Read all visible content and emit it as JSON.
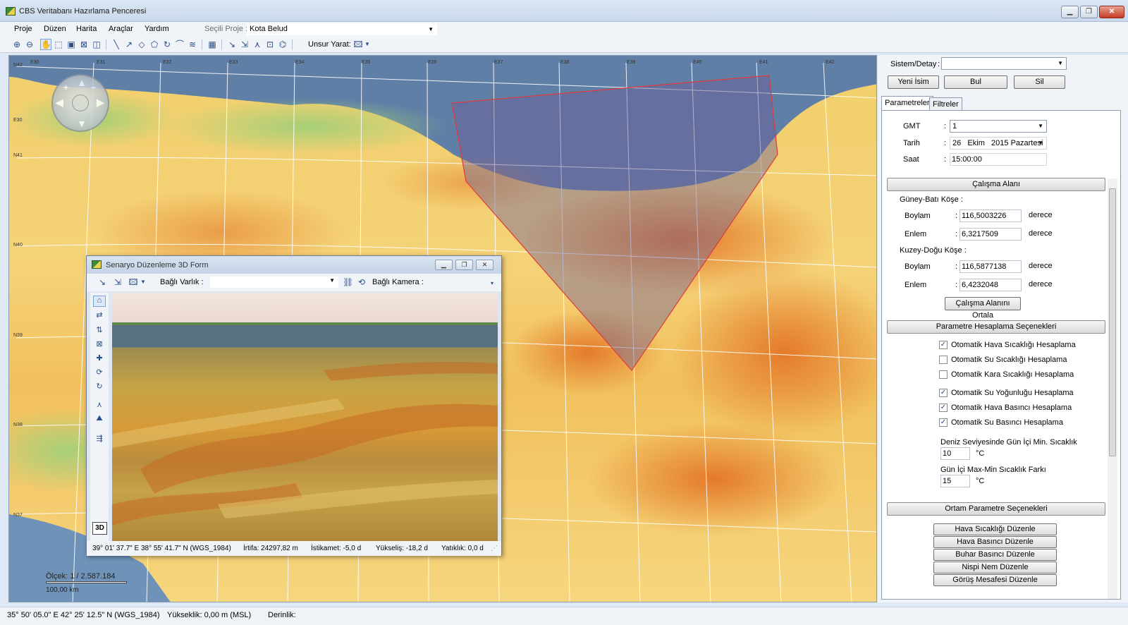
{
  "window": {
    "title": "CBS Veritabanı Hazırlama Penceresi"
  },
  "menu": {
    "items": [
      "Proje",
      "Düzen",
      "Harita",
      "Araçlar",
      "Yardım"
    ],
    "project_label": "Seçili Proje :",
    "project_value": "Kota Belud"
  },
  "toolbar": {
    "unsur_label": "Unsur Yarat:"
  },
  "map": {
    "scale_text": "Ölçek: 1 / 2.587.184",
    "scale_km": "100,00 km"
  },
  "form3d": {
    "title": "Senaryo Düzenleme 3D Form",
    "linked_entity_label": "Bağlı Varlık :",
    "linked_camera_label": "Bağlı Kamera :",
    "btn3d": "3D",
    "status": {
      "coords": "39° 01' 37.7\" E  38° 55' 41.7\" N (WGS_1984)",
      "altitude": "İrtifa: 24297,82 m",
      "heading": "İstikamet: -5,0 d",
      "elevation": "Yükseliş: -18,2 d",
      "tilt": "Yatıklık: 0,0 d"
    }
  },
  "right_panel": {
    "sistem_label": "Sistem/Detay",
    "buttons": {
      "yeni": "Yeni İsim",
      "bul": "Bul",
      "sil": "Sil"
    },
    "tabs": [
      "Parametreler",
      "Filtreler"
    ],
    "gmt_label": "GMT",
    "gmt_value": "1",
    "tarih_label": "Tarih",
    "tarih_day": "26",
    "tarih_month": "Ekim",
    "tarih_rest": "2015 Pazartesi",
    "saat_label": "Saat",
    "saat_value": "15:00:00",
    "calisma_alani": "Çalışma Alanı",
    "sw_label": "Güney-Batı Köşe :",
    "sw_boylam": "116,5003226",
    "sw_enlem": "6,3217509",
    "ne_label": "Kuzey-Doğu Köşe :",
    "ne_boylam": "116,5877138",
    "ne_enlem": "6,4232048",
    "boylam": "Boylam",
    "enlem": "Enlem",
    "derece": "derece",
    "ortala": "Çalışma Alanını Ortala",
    "param_hesap": "Parametre Hesaplama Seçenekleri",
    "checks": [
      {
        "label": "Otomatik Hava Sıcaklığı Hesaplama",
        "checked": "✓"
      },
      {
        "label": "Otomatik Su Sıcaklığı Hesaplama",
        "checked": ""
      },
      {
        "label": "Otomatik Kara Sıcaklığı Hesaplama",
        "checked": ""
      },
      {
        "label": "Otomatik Su Yoğunluğu Hesaplama",
        "checked": "✓"
      },
      {
        "label": "Otomatik Hava Basıncı Hesaplama",
        "checked": "✓"
      },
      {
        "label": "Otomatik Su Basıncı Hesaplama",
        "checked": "✓"
      }
    ],
    "min_temp_label": "Deniz Seviyesinde Gün İçi Min. Sıcaklık",
    "min_temp_value": "10",
    "diff_label": "Gün İçi Max-Min Sıcaklık Farkı",
    "diff_value": "15",
    "unit_c": "°C",
    "ortam": "Ortam Parametre Seçenekleri",
    "edit_buttons": [
      "Hava Sıcaklığı Düzenle",
      "Hava Basıncı Düzenle",
      "Buhar Basıncı Düzenle",
      "Nispi Nem Düzenle",
      "Görüş Mesafesi Düzenle"
    ]
  },
  "status": {
    "coords": "35° 50' 05.0\" E  42° 25' 12.5\" N (WGS_1984)",
    "elevation": "Yükseklik:  0,00 m (MSL)",
    "depth": "Derinlik:"
  },
  "grid": {
    "top": [
      "E30",
      "E31",
      "E32",
      "E33",
      "E34",
      "E35",
      "E36",
      "E37",
      "E38",
      "E39",
      "E40",
      "E41",
      "E42"
    ],
    "left": [
      "N42",
      "E30",
      "N41",
      "N40",
      "N39",
      "N38",
      "N37"
    ]
  }
}
